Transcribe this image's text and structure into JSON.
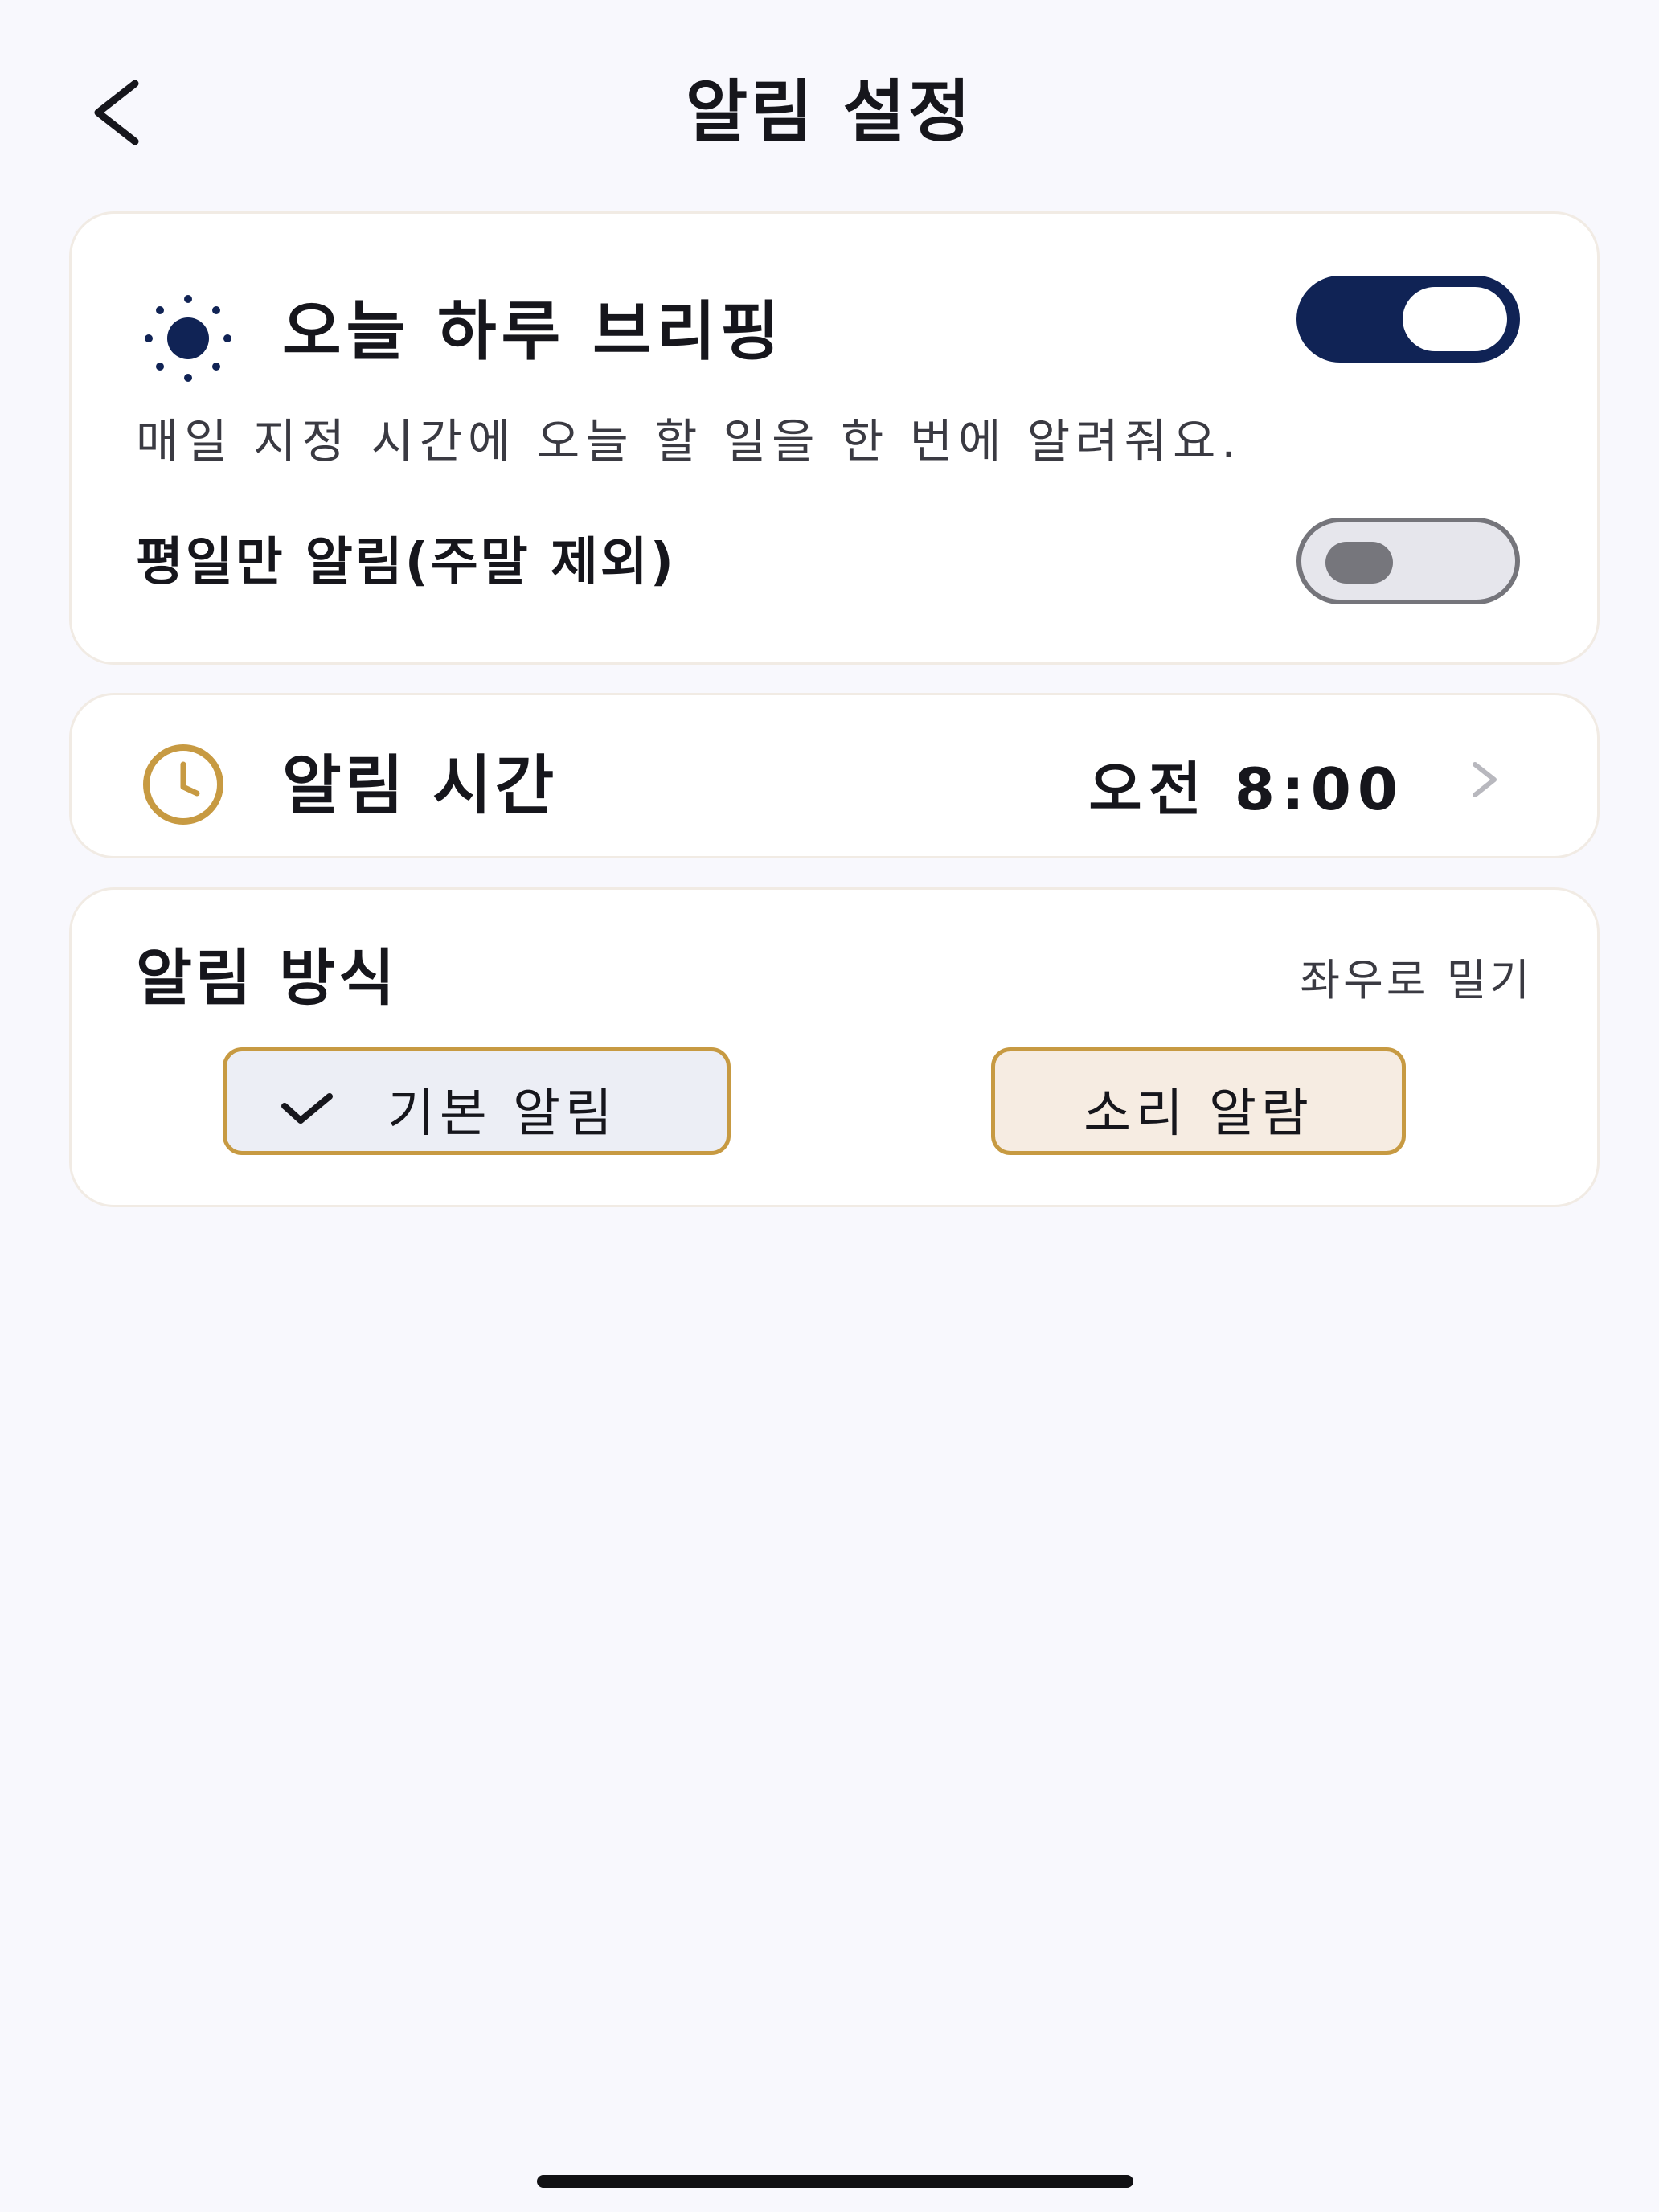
{
  "header": {
    "title": "알림 설정",
    "back_icon": "chevron-left-icon"
  },
  "briefing": {
    "icon": "sun-icon",
    "title": "오늘 하루 브리핑",
    "enabled": true,
    "description": "매일 지정 시간에 오늘 할 일을 한 번에 알려줘요.",
    "weekday_label": "평일만 알림(주말 제외)",
    "weekday_only": false
  },
  "alarm_time": {
    "icon": "clock-icon",
    "label": "알림 시간",
    "value": "오전 8:00",
    "chevron_icon": "chevron-right-icon"
  },
  "alarm_method": {
    "title": "알림 방식",
    "hint": "좌우로 밀기",
    "options": [
      {
        "label": "기본 알림",
        "selected": true,
        "icon": "check-icon"
      },
      {
        "label": "소리 알람",
        "selected": false
      }
    ]
  },
  "colors": {
    "background": "#f8f8fd",
    "toggle_on": "#102355",
    "accent_gold": "#c79a42",
    "toggle_off": "#e6e6ec"
  }
}
